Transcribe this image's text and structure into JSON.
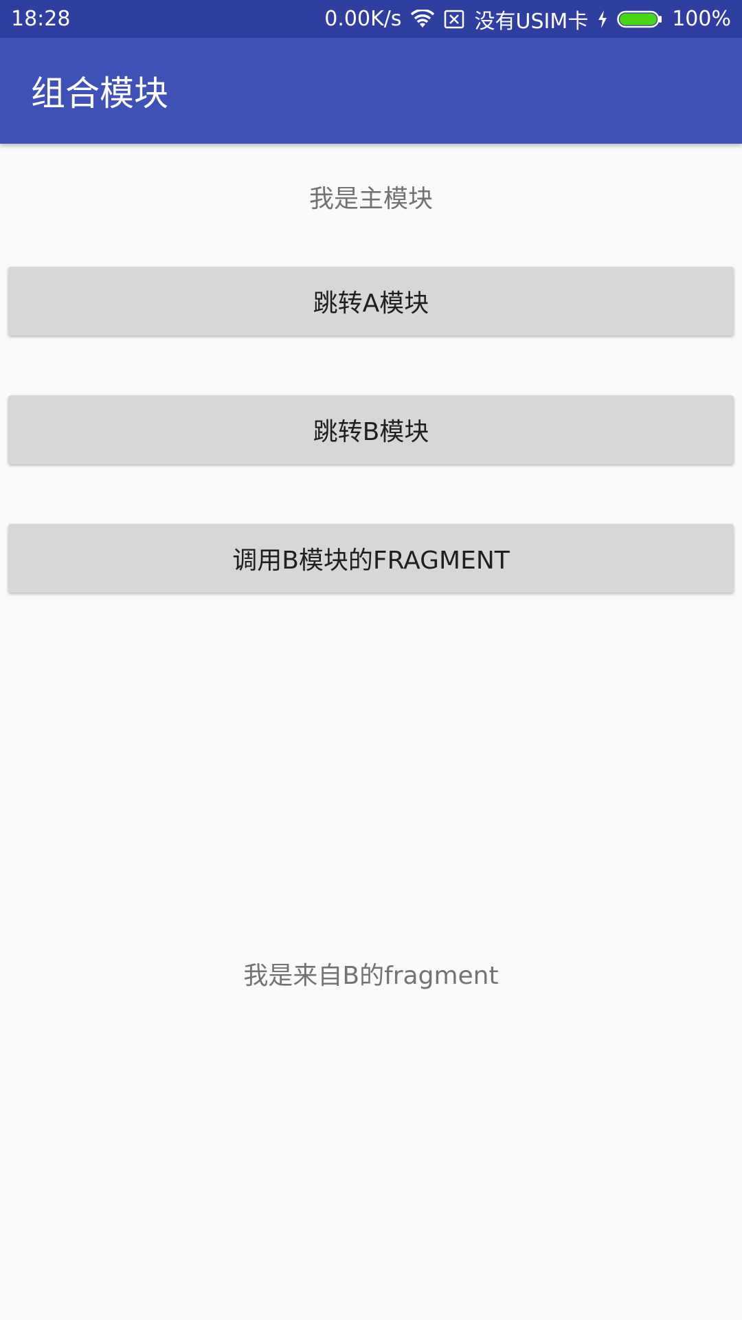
{
  "status_bar": {
    "time": "18:28",
    "net_speed": "0.00K/s",
    "sim_status": "没有USIM卡",
    "battery_percent": "100%",
    "battery_level": 1.0,
    "icons": [
      "wifi-icon",
      "no-sim-icon",
      "charging-icon",
      "battery-icon"
    ],
    "color": "#303f9f"
  },
  "toolbar": {
    "title": "组合模块",
    "color": "#3f51b5"
  },
  "main": {
    "label": "我是主模块",
    "buttons": [
      {
        "label": "跳转A模块"
      },
      {
        "label": "跳转B模块"
      },
      {
        "label": "调用B模块的FRAGMENT"
      }
    ],
    "fragment_text": "我是来自B的fragment"
  }
}
